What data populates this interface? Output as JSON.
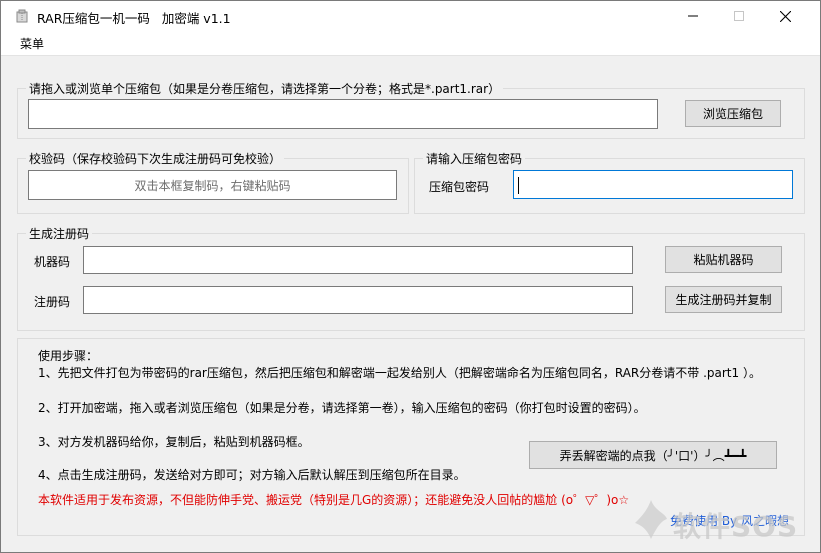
{
  "window": {
    "title": "RAR压缩包一机一码   加密端 v1.1",
    "menu_label": "菜单"
  },
  "archive": {
    "group_title": "请拖入或浏览单个压缩包（如果是分卷压缩包，请选择第一个分卷；格式是*.part1.rar）",
    "path_value": "",
    "browse_label": "浏览压缩包"
  },
  "checksum": {
    "group_title": "校验码（保存校验码下次生成注册码可免校验）",
    "hint": "双击本框复制码，右键粘贴码"
  },
  "password": {
    "group_title": "请输入压缩包密码",
    "field_label": "压缩包密码",
    "value": ""
  },
  "register": {
    "group_title": "生成注册码",
    "machine_label": "机器码",
    "machine_value": "",
    "paste_label": "粘贴机器码",
    "code_label": "注册码",
    "code_value": "",
    "generate_label": "生成注册码并复制"
  },
  "instructions": {
    "heading": "使用步骤：",
    "steps": [
      "1、先把文件打包为带密码的rar压缩包，然后把压缩包和解密端一起发给别人（把解密端命名为压缩包同名，RAR分卷请不带 .part1 ）。",
      "2、打开加密端，拖入或者浏览压缩包（如果是分卷，请选择第一卷），输入压缩包的密码（你打包时设置的密码）。",
      "3、对方发机器码给你，复制后，粘贴到机器码框。",
      "4、点击生成注册码，发送给对方即可；对方输入后默认解压到压缩包所在目录。"
    ],
    "notice": "本软件适用于发布资源，不但能防伸手党、搬运党（特别是几G的资源）；还能避免没人回帖的尴尬 (o゜▽゜)o☆",
    "fun_button_label": "弄丢解密端的点我（╯'口'）╯︵┻━┻",
    "credit": "免费使用 By 风之暇想"
  },
  "watermark": {
    "text": "软件SOS"
  },
  "colors": {
    "accent": "#0078d7",
    "notice_red": "#e00000",
    "credit_blue": "#1f5dd6"
  },
  "icons": [
    "app-icon",
    "minimize-icon",
    "maximize-icon",
    "close-icon"
  ]
}
